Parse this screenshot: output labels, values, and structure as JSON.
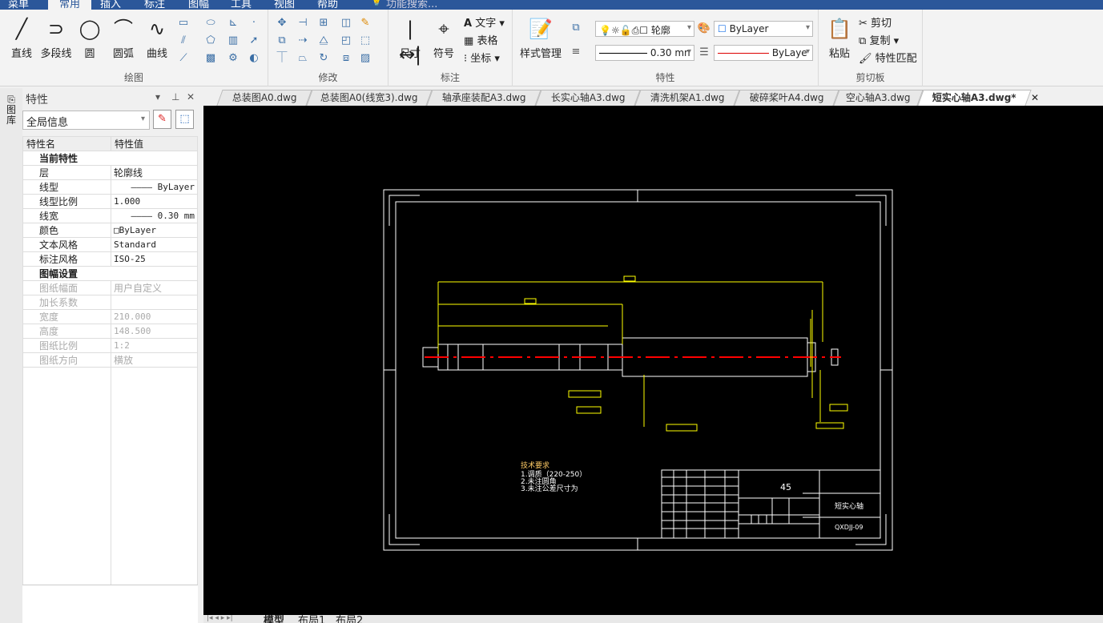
{
  "menu": {
    "tabs": [
      "菜单",
      "常用",
      "插入",
      "标注",
      "图幅",
      "工具",
      "视图",
      "帮助"
    ],
    "active": "常用",
    "search": "功能搜索..."
  },
  "ribbon": {
    "draw": {
      "label": "绘图",
      "line": "直线",
      "polyline": "多段线",
      "circle": "圆",
      "arc": "圆弧",
      "curve": "曲线"
    },
    "modify": {
      "label": "修改"
    },
    "annotate": {
      "label": "标注",
      "dimension": "尺寸",
      "symbol": "符号",
      "text": "文字",
      "table": "表格",
      "coordinate": "坐标"
    },
    "properties": {
      "label": "特性",
      "style_manager": "样式管理",
      "layer": "轮廓",
      "color": "ByLayer",
      "lineweight": "0.30 mn",
      "linetype": "ByLaye"
    },
    "clipboard": {
      "label": "剪切板",
      "paste": "粘贴",
      "cut": "剪切",
      "copy": "复制",
      "match": "特性匹配"
    }
  },
  "panel": {
    "side_label": "图库",
    "title": "特性",
    "selector": "全局信息",
    "headers": [
      "特性名",
      "特性值"
    ],
    "group1": "当前特性",
    "rows1": [
      [
        "层",
        "轮廓线"
      ],
      [
        "线型",
        "———— ByLayer"
      ],
      [
        "线型比例",
        "1.000"
      ],
      [
        "线宽",
        "———— 0.30 mm"
      ],
      [
        "颜色",
        "□ByLayer"
      ],
      [
        "文本风格",
        "Standard"
      ],
      [
        "标注风格",
        "ISO-25"
      ]
    ],
    "group2": "图幅设置",
    "rows2": [
      [
        "图纸幅面",
        "用户自定义"
      ],
      [
        "加长系数",
        ""
      ],
      [
        "宽度",
        "210.000"
      ],
      [
        "高度",
        "148.500"
      ],
      [
        "图纸比例",
        "1:2"
      ],
      [
        "图纸方向",
        "横放"
      ]
    ]
  },
  "doc_tabs": [
    "总装图A0.dwg",
    "总装图A0(线宽3).dwg",
    "轴承座装配A3.dwg",
    "长实心轴A3.dwg",
    "清洗机架A1.dwg",
    "破碎桨叶A4.dwg",
    "空心轴A3.dwg",
    "短实心轴A3.dwg*"
  ],
  "drawing": {
    "material": "45",
    "part_name": "短实心轴",
    "drawing_no": "QXDJJ-09",
    "tech_title": "技术要求",
    "tech_lines": [
      "1.调质（220-250）",
      "2.未注圆角",
      "3.未注公差尺寸为"
    ]
  },
  "layout_tabs": [
    "模型",
    "布局1",
    "布局2"
  ],
  "colors": {
    "menubar": "#2b579a",
    "canvas": "#000000",
    "yellow": "#ffff00",
    "red": "#ff0000"
  }
}
